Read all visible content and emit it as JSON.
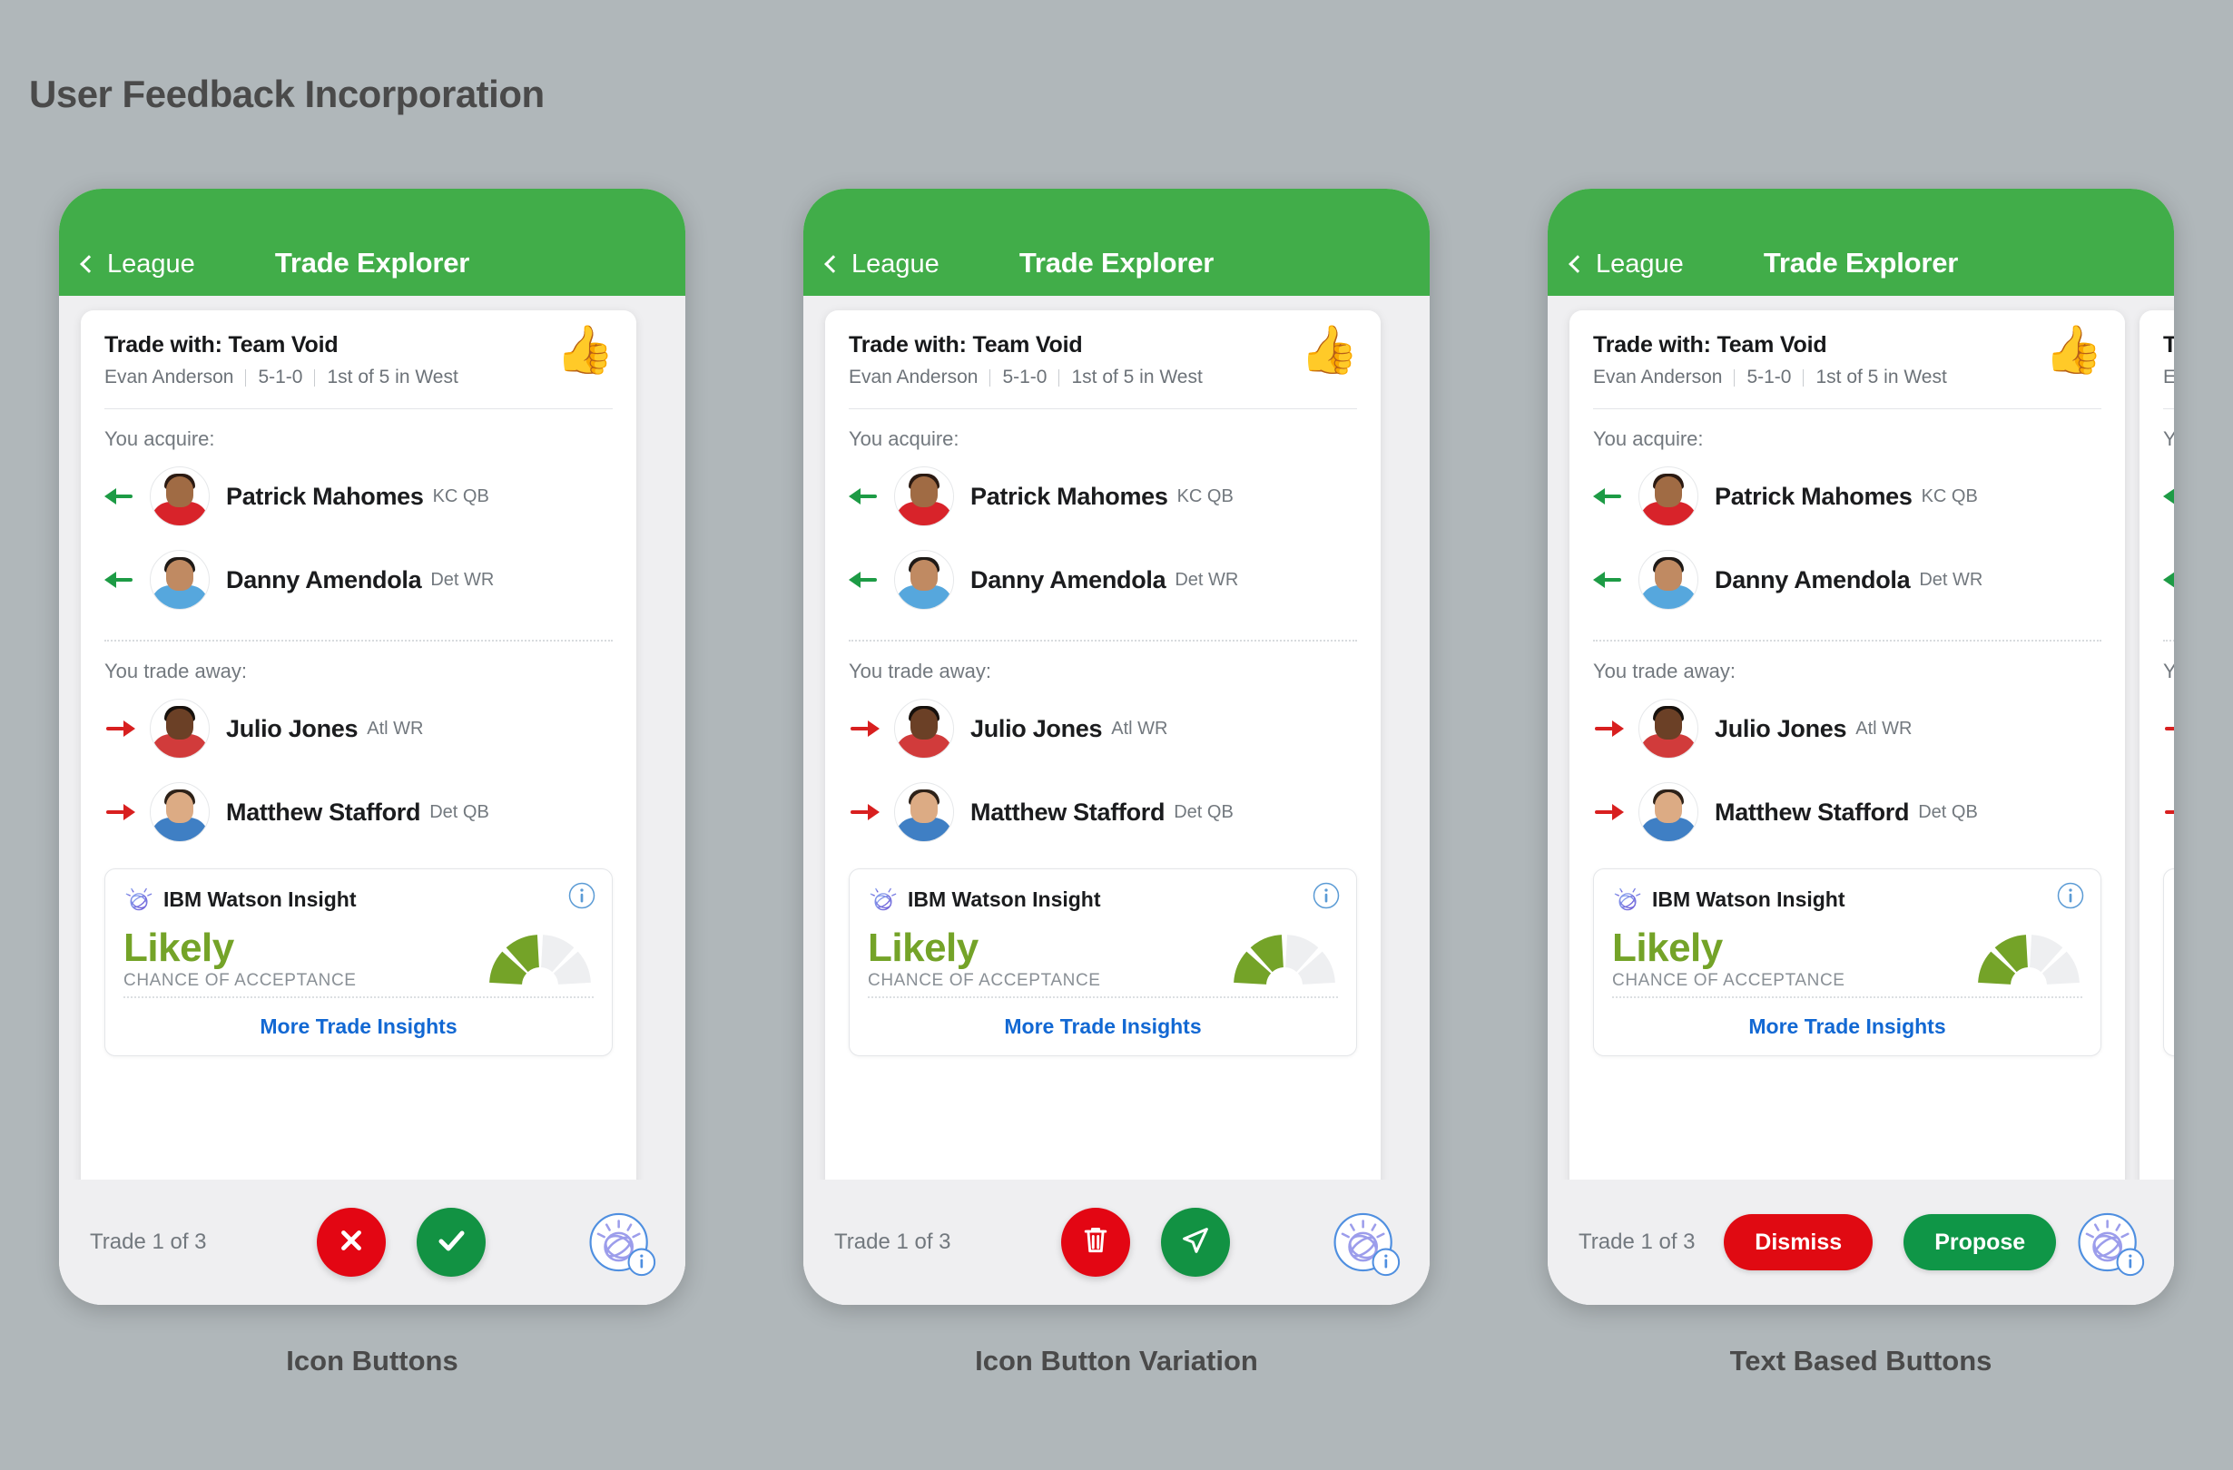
{
  "page": {
    "title": "User Feedback Incorporation"
  },
  "nav": {
    "back_label": "League",
    "title": "Trade Explorer",
    "green": "#41ad49"
  },
  "card": {
    "team_line": "Trade with: Team Void",
    "manager": "Evan Anderson",
    "record": "5-1-0",
    "standing": "1st of 5 in West",
    "foam_finger_icon": "👍",
    "acquire_label": "You acquire:",
    "trade_away_label": "You trade away:"
  },
  "acquire": [
    {
      "name": "Patrick Mahomes",
      "pos": "KC QB",
      "direction": "in"
    },
    {
      "name": "Danny Amendola",
      "pos": "Det WR",
      "direction": "in"
    }
  ],
  "trade_away": [
    {
      "name": "Julio Jones",
      "pos": "Atl WR",
      "direction": "out"
    },
    {
      "name": "Matthew Stafford",
      "pos": "Det QB",
      "direction": "out"
    }
  ],
  "insight": {
    "title": "IBM Watson Insight",
    "verdict": "Likely",
    "verdict_color": "#74a328",
    "caption": "CHANCE OF ACCEPTANCE",
    "link": "More Trade Insights",
    "link_color": "#1268d3",
    "gauge_filled": 2,
    "gauge_total": 4,
    "info_icon": "info-icon"
  },
  "bottom": {
    "trade_count": "Trade 1 of 3",
    "fab_icon": "watson-icon",
    "fab_badge": "i"
  },
  "variants": [
    {
      "caption": "Icon Buttons",
      "negative": {
        "style": "circle",
        "icon": "close-icon",
        "label": "",
        "color": "#e30613"
      },
      "positive": {
        "style": "circle",
        "icon": "check-icon",
        "label": "",
        "color": "#129243"
      }
    },
    {
      "caption": "Icon Button Variation",
      "negative": {
        "style": "circle",
        "icon": "trash-icon",
        "label": "",
        "color": "#e30613"
      },
      "positive": {
        "style": "circle",
        "icon": "send-icon",
        "label": "",
        "color": "#129243"
      }
    },
    {
      "caption": "Text Based Buttons",
      "negative": {
        "style": "pill",
        "icon": "",
        "label": "Dismiss",
        "color": "#e00a12"
      },
      "positive": {
        "style": "pill",
        "icon": "",
        "label": "Propose",
        "color": "#0f9647"
      }
    }
  ]
}
